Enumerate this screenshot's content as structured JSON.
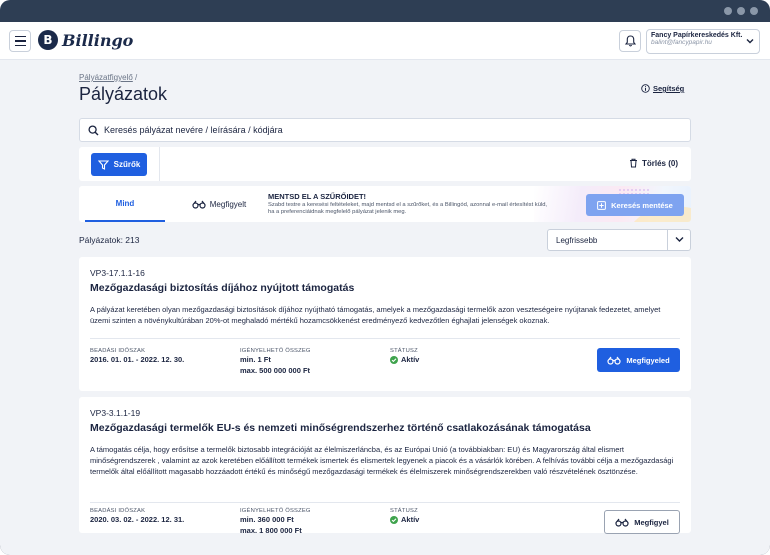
{
  "topbar": {
    "logo_mark": "B",
    "logo_text": "Billingo",
    "account": {
      "name": "Fancy Papírkereskedés Kft.",
      "email": "balint@fancypapir.hu"
    }
  },
  "page": {
    "breadcrumb_link": "Pályázatfigyelő",
    "breadcrumb_sep": "/",
    "title": "Pályázatok",
    "help_label": "Segítség"
  },
  "search": {
    "placeholder": "Keresés pályázat nevére / leírására / kódjára"
  },
  "filters": {
    "filter_label": "Szűrők",
    "clear_label": "Törlés (0)"
  },
  "tabs": {
    "all_label": "Mind",
    "watched_label": "Megfigyelt",
    "promo_title": "MENTSD EL A SZŰRŐIDET!",
    "promo_text": "Szabd testre a keresési feltételeket, majd mentsd el a szűrőket, és a Billingód, azonnal e-mail értesítést küld, ha a preferenciáidnak megfelelő pályázat jelenik meg.",
    "save_label": "Keresés mentése"
  },
  "list": {
    "count_label": "Pályázatok: 213",
    "sort_value": "Legfrissebb"
  },
  "labels": {
    "period": "BEADÁSI IDŐSZAK",
    "amount": "IGÉNYELHETŐ ÖSSZEG",
    "status": "STÁTUSZ"
  },
  "cards": [
    {
      "code": "VP3-17.1.1-16",
      "title": "Mezőgazdasági biztosítás díjához nyújtott támogatás",
      "description": "A pályázat keretében olyan mezőgazdasági biztosítások díjához nyújtható támogatás, amelyek a mezőgazdasági termelők azon veszteségeire nyújtanak fedezetet, amelyet üzemi szinten a növénykultúrában 20%-ot meghaladó mértékű hozamcsökkenést eredményező kedvezőtlen éghajlati jelenségek okoznak.",
      "period": "2016. 01. 01. - 2022. 12. 30.",
      "amount_min": "min. 1 Ft",
      "amount_max": "max. 500 000 000 Ft",
      "status": "Aktív",
      "button": "Megfigyeled"
    },
    {
      "code": "VP3-3.1.1-19",
      "title": "Mezőgazdasági termelők EU-s és nemzeti minőségrendszerhez történő csatlakozásának támogatása",
      "description": "A támogatás célja, hogy erősítse a termelők biztosabb integrációját az élelmiszerláncba, és az Európai Unió (a továbbiakban: EU) és Magyarország által elismert minőségrendszerek , valamint az azok keretében előállított termékek ismertek és elismertek legyenek a piacok és a vásárlók körében. A felhívás további célja a mezőgazdasági termelők által előállított magasabb hozzáadott értékű és minőségű mezőgazdasági termékek és élelmiszerek minőségrendszerekben való részvételének ösztönzése.",
      "period": "2020. 03. 02. - 2022. 12. 31.",
      "amount_min": "min. 360 000 Ft",
      "amount_max": "max. 1 800 000 Ft",
      "status": "Aktív",
      "button": "Megfigyel"
    }
  ],
  "colors": {
    "primary": "#1f5fe0",
    "status_active": "#3fa34d",
    "text": "#1b2440",
    "window": "#2e3e54"
  }
}
